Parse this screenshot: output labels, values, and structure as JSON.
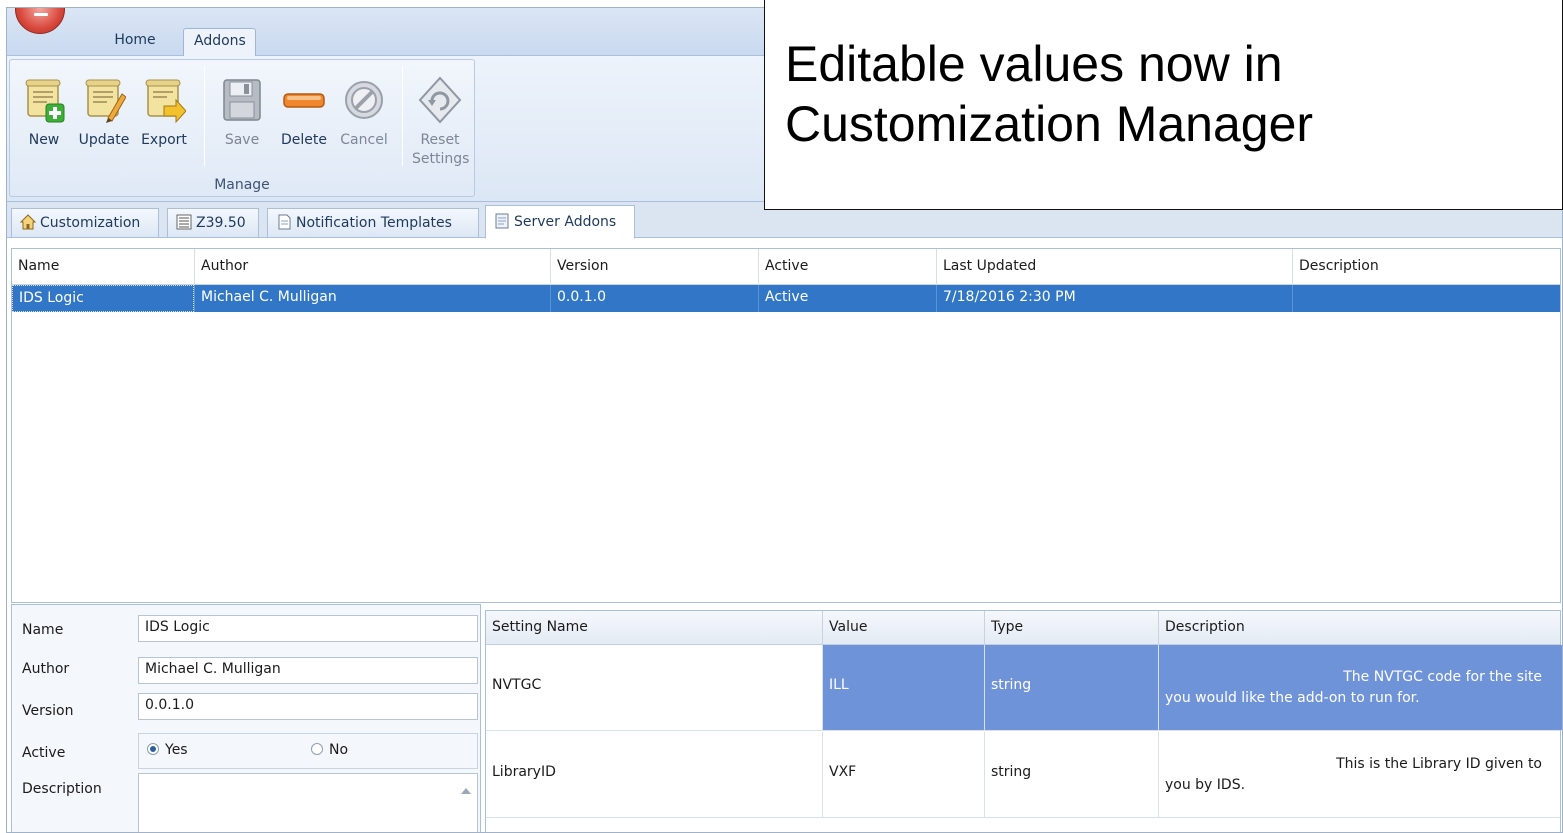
{
  "ribbon": {
    "tabs": [
      "Home",
      "Addons"
    ],
    "buttons": {
      "new": "New",
      "update": "Update",
      "export": "Export",
      "save": "Save",
      "delete": "Delete",
      "cancel": "Cancel",
      "reset_line1": "Reset",
      "reset_line2": "Settings"
    },
    "group_label": "Manage"
  },
  "callout": {
    "line1": "Editable values now in",
    "line2": "Customization Manager"
  },
  "doc_tabs": [
    "Customization",
    "Z39.50",
    "Notification Templates",
    "Server Addons"
  ],
  "addons_grid": {
    "columns": [
      "Name",
      "Author",
      "Version",
      "Active",
      "Last Updated",
      "Description"
    ],
    "rows": [
      {
        "name": "IDS Logic",
        "author": "Michael C. Mulligan",
        "version": "0.0.1.0",
        "active": "Active",
        "last_updated": "7/18/2016 2:30 PM",
        "description": ""
      }
    ]
  },
  "details": {
    "labels": {
      "name": "Name",
      "author": "Author",
      "version": "Version",
      "active": "Active",
      "description": "Description"
    },
    "values": {
      "name": "IDS Logic",
      "author": "Michael C. Mulligan",
      "version": "0.0.1.0"
    },
    "active_options": {
      "yes": "Yes",
      "no": "No",
      "selected": "Yes"
    }
  },
  "settings_grid": {
    "columns": [
      "Setting Name",
      "Value",
      "Type",
      "Description"
    ],
    "rows": [
      {
        "setting_name": "NVTGC",
        "value": "ILL",
        "type": "string",
        "description_line1": "The NVTGC code for the site",
        "description_line2": "you would like the add-on to run for."
      },
      {
        "setting_name": "LibraryID",
        "value": "VXF",
        "type": "string",
        "description_line1": "This is the Library ID given to",
        "description_line2": "you by IDS."
      }
    ]
  },
  "colors": {
    "selection": "#3276c8",
    "setting_selection": "#6f93d9",
    "ribbon": "#dce7f5"
  }
}
